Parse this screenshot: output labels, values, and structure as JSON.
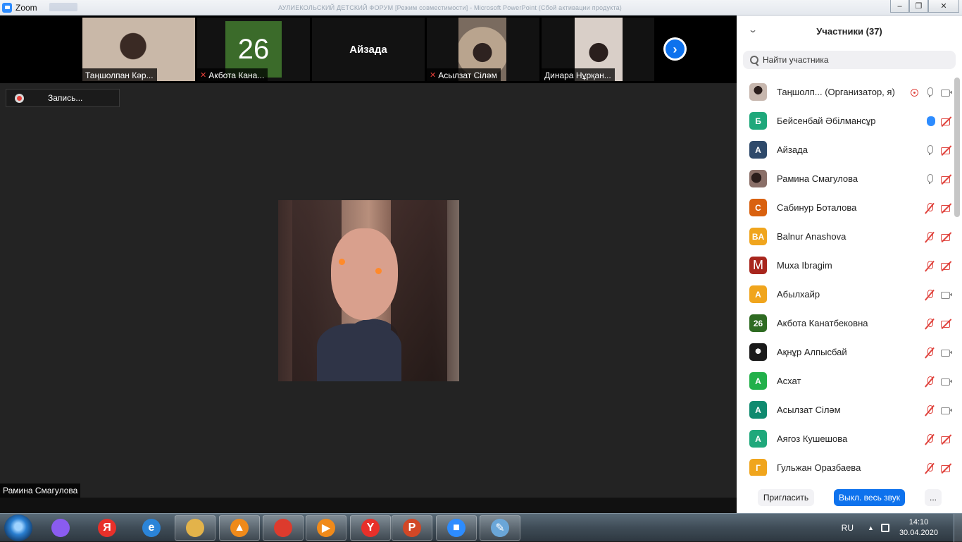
{
  "window": {
    "title": "Zoom",
    "doc_title": "АУЛИЕКОЛЬСКИЙ ДЕТСКИЙ ФОРУМ [Режим совместимости] - Microsoft PowerPoint (Сбой активации продукта)"
  },
  "strip": {
    "tiles": [
      {
        "name": "Таңшолпан Кәр...",
        "muted": false
      },
      {
        "name": "Акбота Кана...",
        "muted": true,
        "avatar_text": "26"
      },
      {
        "name": "Айзада",
        "muted": false
      },
      {
        "name": "Асылзат Сіләм",
        "muted": true
      },
      {
        "name": "Динара Нұрқан...",
        "muted": false
      }
    ]
  },
  "recording": {
    "label": "Запись..."
  },
  "speaker": {
    "name": "Рамина Смагулова"
  },
  "panel": {
    "title": "Участники (37)",
    "search_placeholder": "Найти участника",
    "participants": [
      {
        "name": "Таңшолп...  (Организатор, я)",
        "avatar": "photo",
        "mic": "on",
        "cam": "on",
        "recording": true
      },
      {
        "name": "Бейсенбай Әбілмансұр",
        "avatar": "Б",
        "color": "#1fa87b",
        "mic": "hand",
        "cam": "off"
      },
      {
        "name": "Айзада",
        "avatar": "А",
        "color": "#2f4a6b",
        "mic": "on",
        "cam": "off"
      },
      {
        "name": "Рамина Смагулова",
        "avatar": "photo",
        "mic": "on",
        "cam": "off"
      },
      {
        "name": "Сабинур Боталова",
        "avatar": "С",
        "color": "#d9610f",
        "mic": "off",
        "cam": "off"
      },
      {
        "name": "Balnur Anashova",
        "avatar": "BA",
        "color": "#f0a51d",
        "mic": "off",
        "cam": "off"
      },
      {
        "name": "Muxa Ibragim",
        "avatar": "M",
        "color": "#a8261d",
        "mic": "off",
        "cam": "off"
      },
      {
        "name": "Абылхайр",
        "avatar": "А",
        "color": "#f0a51d",
        "mic": "off",
        "cam": "on"
      },
      {
        "name": "Акбота Канатбековна",
        "avatar": "26",
        "color": "#2e6b22",
        "mic": "off",
        "cam": "off"
      },
      {
        "name": "Ақнұр Алпысбай",
        "avatar": "photo",
        "mic": "off",
        "cam": "on"
      },
      {
        "name": "Асхат",
        "avatar": "А",
        "color": "#22b04a",
        "mic": "off",
        "cam": "on"
      },
      {
        "name": "Асылзат Сіләм",
        "avatar": "А",
        "color": "#0f8a6f",
        "mic": "off",
        "cam": "on"
      },
      {
        "name": "Аягоз Кушешова",
        "avatar": "А",
        "color": "#1fa87b",
        "mic": "off",
        "cam": "off"
      },
      {
        "name": "Гульжан Оразбаева",
        "avatar": "Г",
        "color": "#f0a51d",
        "mic": "off",
        "cam": "off"
      }
    ],
    "invite_label": "Пригласить",
    "mute_all_label": "Выкл. весь звук",
    "more_label": "..."
  },
  "taskbar": {
    "apps": [
      {
        "name": "alice",
        "color": "#8a5cf0",
        "glyph": ""
      },
      {
        "name": "yandex-browser-old",
        "color": "#e8302a",
        "glyph": "Я"
      },
      {
        "name": "internet-explorer",
        "color": "#2b84d8",
        "glyph": "e"
      },
      {
        "name": "file-explorer",
        "color": "#e3b34a",
        "glyph": ""
      },
      {
        "name": "aimp",
        "color": "#f08a1a",
        "glyph": "▲"
      },
      {
        "name": "chrome",
        "color": "#dd3b2d",
        "glyph": ""
      },
      {
        "name": "video-player",
        "color": "#f08a1a",
        "glyph": "▶"
      },
      {
        "name": "yandex-browser",
        "color": "#e8302a",
        "glyph": "Y"
      },
      {
        "name": "powerpoint",
        "color": "#d24726",
        "glyph": "P"
      },
      {
        "name": "zoom",
        "color": "#2d8cff",
        "glyph": "■"
      },
      {
        "name": "paint",
        "color": "#6aa6d8",
        "glyph": "✎"
      }
    ],
    "lang": "RU",
    "time": "14:10",
    "date": "30.04.2020"
  }
}
